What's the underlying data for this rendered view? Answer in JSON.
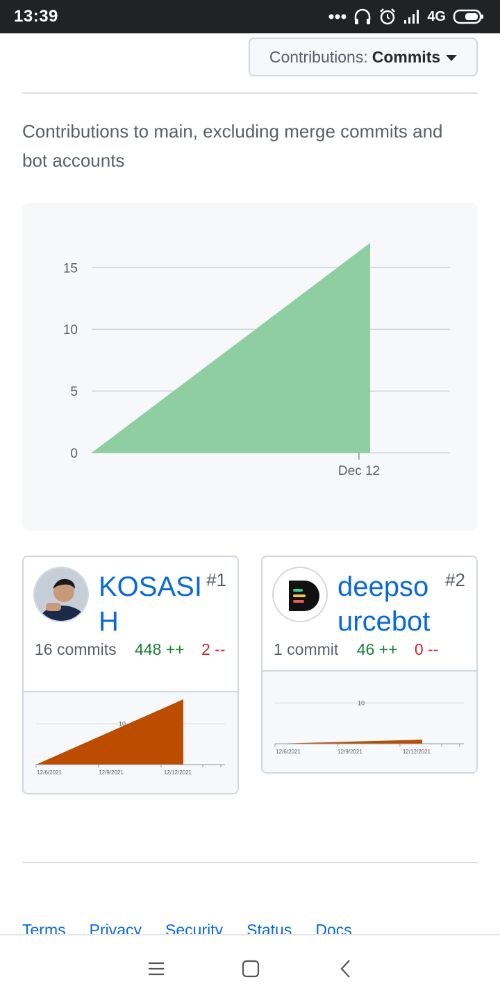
{
  "status_bar": {
    "time": "13:39",
    "network": "4G"
  },
  "dropdown": {
    "prefix": "Contributions:",
    "value": "Commits"
  },
  "description": "Contributions to main, excluding merge commits and bot accounts",
  "chart_data": {
    "type": "area",
    "x_tick_labels": [
      "Dec 12"
    ],
    "y_ticks": [
      0,
      5,
      10,
      15
    ],
    "ylim": [
      0,
      18
    ],
    "series": [
      {
        "points": [
          [
            0,
            0
          ],
          [
            1,
            17
          ]
        ],
        "color": "#8fcea1"
      }
    ]
  },
  "contributors": [
    {
      "name": "KOSASIH",
      "rank": "#1",
      "commits": "16 commits",
      "additions": "448 ++",
      "deletions": "2 --",
      "mini_chart": {
        "y_tick": "10",
        "x_labels": [
          "12/6/2021",
          "12/9/2021",
          "12/12/2021"
        ],
        "ylim": [
          0,
          16
        ],
        "end_value": 16,
        "color": "#bc4c00"
      }
    },
    {
      "name": "deepsourcebot",
      "rank": "#2",
      "commits": "1 commit",
      "additions": "46 ++",
      "deletions": "0 --",
      "mini_chart": {
        "y_tick": "10",
        "x_labels": [
          "12/6/2021",
          "12/9/2021",
          "12/12/2021"
        ],
        "ylim": [
          0,
          16
        ],
        "end_value": 1,
        "color": "#bc4c00"
      }
    }
  ],
  "footer": {
    "links": [
      "Terms",
      "Privacy",
      "Security",
      "Status",
      "Docs"
    ]
  },
  "nav": {
    "menu_icon": "menu-icon",
    "home_icon": "home-icon",
    "back_icon": "back-icon"
  }
}
